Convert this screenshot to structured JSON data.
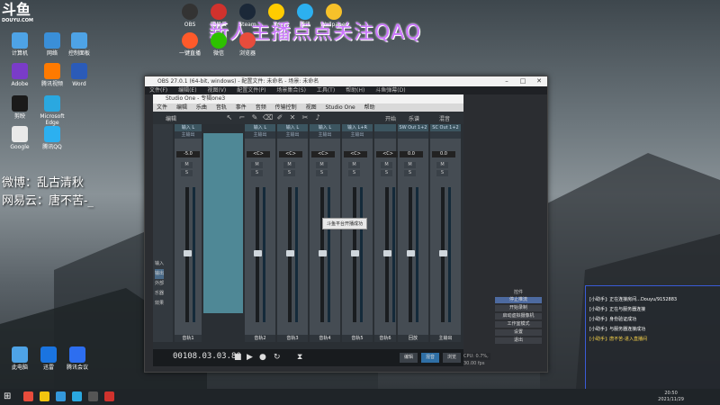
{
  "logo": {
    "text": "斗鱼",
    "sub": "DOUYU.COM"
  },
  "banner": "新人主播点点关注QAQ",
  "side_text": {
    "weibo": "微博：乱古清秋",
    "netease": "网易云：唐不苦-_"
  },
  "desktop_icons": [
    {
      "label": "计算机",
      "color": "#4ea3e6"
    },
    {
      "label": "Adobe",
      "color": "#7a3cc8"
    },
    {
      "label": "剪映",
      "color": "#1a1a1a"
    },
    {
      "label": "Google",
      "color": "#e9e9e9"
    },
    {
      "label": "网络",
      "color": "#3a8fd8"
    },
    {
      "label": "腾讯视频",
      "color": "#ff7a00"
    },
    {
      "label": "Microsoft Edge",
      "color": "#2aa8e0"
    },
    {
      "label": "腾讯QQ",
      "color": "#2cb0f0"
    },
    {
      "label": "控制面板",
      "color": "#4ea3e6"
    },
    {
      "label": "Word",
      "color": "#2b5bb8"
    },
    {
      "label": "此电脑",
      "color": "#4ea3e6"
    },
    {
      "label": "迅雷",
      "color": "#1a74e0"
    },
    {
      "label": "腾讯会议",
      "color": "#2d6ef0"
    }
  ],
  "top_icons": [
    {
      "label": "OBS",
      "color": "#333333"
    },
    {
      "label": "网易云",
      "color": "#d0322d"
    },
    {
      "label": "Steam",
      "color": "#1b2838"
    },
    {
      "label": "YY",
      "color": "#ffcc00"
    },
    {
      "label": "腾讯",
      "color": "#2cb0f0"
    },
    {
      "label": "Wallpaper",
      "color": "#f6c12a"
    },
    {
      "label": "一键直播",
      "color": "#ff5a2a"
    },
    {
      "label": "微信",
      "color": "#2dc100"
    },
    {
      "label": "浏览器",
      "color": "#e74c3c"
    }
  ],
  "obs": {
    "title": "OBS 27.0.1 (64-bit, windows) - 配置文件: 未命名 - 场景: 未命名",
    "menu": [
      "文件(F)",
      "编辑(E)",
      "视图(V)",
      "配置文件(P)",
      "场景集合(S)",
      "工具(T)",
      "帮助(H)",
      "斗鱼弹幕(D)"
    ],
    "controls_title": "控件",
    "controls": [
      "停止推流",
      "开始录制",
      "启动虚拟摄像机",
      "工作室模式",
      "设置",
      "退出"
    ],
    "status": "CPU: 0.7%, 30.00 fps"
  },
  "studio_one": {
    "title": "Studio One - 专辑one3",
    "menu": [
      "文件",
      "编辑",
      "乐曲",
      "音轨",
      "事件",
      "音频",
      "传输控制",
      "视图",
      "Studio One",
      "帮助"
    ],
    "toolbar_left": "编辑",
    "toolbar_right": [
      "开始",
      "乐谱",
      "混音"
    ],
    "strips": [
      {
        "hdr": "输入 L",
        "sub": "主输出",
        "val": "-5.0",
        "name": "音轨1"
      },
      {
        "hdr": "输入 L",
        "sub": "主输出",
        "val": "<C>",
        "name": "音轨2"
      },
      {
        "hdr": "输入 L",
        "sub": "主输出",
        "val": "<C>",
        "name": "音轨3"
      },
      {
        "hdr": "输入 L",
        "sub": "主输出",
        "val": "<C>",
        "name": "音轨4"
      },
      {
        "hdr": "输入 L+R",
        "sub": "主输出",
        "val": "<C>",
        "name": "音轨5"
      },
      {
        "hdr": "",
        "sub": "",
        "val": "<C>",
        "name": "音轨6"
      },
      {
        "hdr": "SW Out 1+2",
        "sub": "",
        "val": "0.0",
        "name": "回放"
      },
      {
        "hdr": "SC Out 1+2",
        "sub": "",
        "val": "0.0",
        "name": "主输出"
      }
    ],
    "tooltip": "斗鱼平台开播成功",
    "side_panel": [
      "输入",
      "输出",
      "外部",
      "乐器",
      "效果"
    ],
    "transport_time": "00108.03.03.80",
    "tabs": [
      "编辑",
      "混音",
      "浏览"
    ]
  },
  "chat": [
    {
      "text": "[小助手]: 正在连接房间...Douyu/9152883",
      "highlight": false
    },
    {
      "text": "[小助手]: 正在与服务器连接",
      "highlight": false
    },
    {
      "text": "[小助手]: 身份验证成功",
      "highlight": false
    },
    {
      "text": "[小助手]: 与服务器连接成功",
      "highlight": false
    },
    {
      "text": "[小助手]: 唐不苦-进入直播间",
      "highlight": true
    }
  ],
  "clock": {
    "time": "20:50",
    "date": "2021/11/29"
  }
}
